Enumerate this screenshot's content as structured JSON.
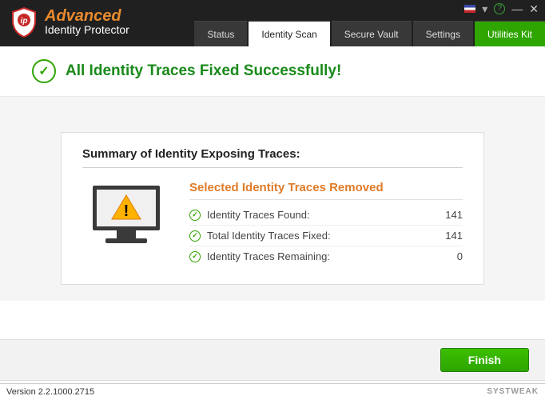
{
  "brand": {
    "line1": "Advanced",
    "line2": "Identity Protector"
  },
  "titlebar": {
    "lang_dropdown": "▾",
    "help": "?",
    "minimize": "—",
    "close": "✕"
  },
  "nav": {
    "tabs": [
      {
        "label": "Status"
      },
      {
        "label": "Identity Scan"
      },
      {
        "label": "Secure Vault"
      },
      {
        "label": "Settings"
      },
      {
        "label": "Utilities Kit"
      }
    ]
  },
  "banner": {
    "message": "All Identity Traces Fixed Successfully!"
  },
  "summary": {
    "heading": "Summary of Identity Exposing Traces:",
    "subtitle": "Selected Identity Traces Removed",
    "rows": [
      {
        "label": "Identity Traces Found:",
        "value": "141"
      },
      {
        "label": "Total Identity Traces Fixed:",
        "value": "141"
      },
      {
        "label": "Identity Traces Remaining:",
        "value": "0"
      }
    ]
  },
  "footer": {
    "finish": "Finish"
  },
  "version": {
    "text": "Version 2.2.1000.2715",
    "watermark": "SYSTWEAK"
  }
}
